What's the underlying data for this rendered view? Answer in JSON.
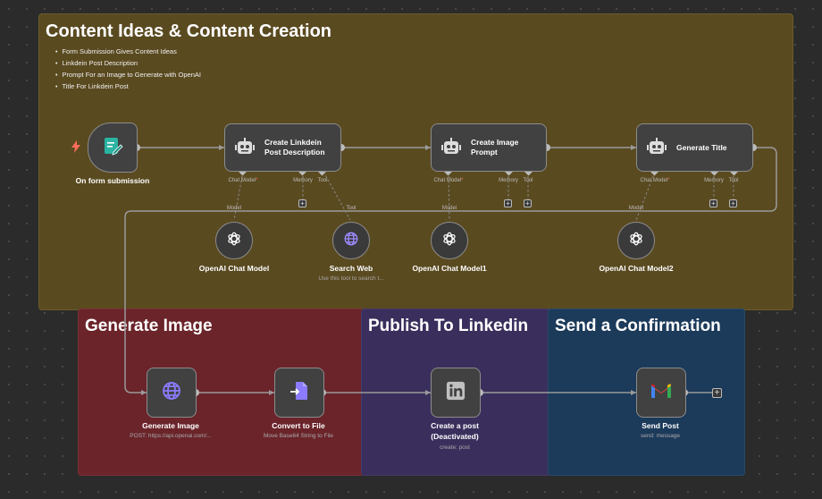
{
  "sticky_main": {
    "title": "Content Ideas & Content Creation",
    "bullets": [
      "Form Submission Gives Content Ideas",
      "Linkdein Post Description",
      "Prompt For an Image to Generate with OpenAI",
      "Title For Linkdein Post"
    ]
  },
  "sticky_image": {
    "title": "Generate Image"
  },
  "sticky_linkedin": {
    "title": "Publish To Linkedin"
  },
  "sticky_send": {
    "title": "Send a Confirmation"
  },
  "nodes": {
    "trigger": {
      "label": "On form submission"
    },
    "agent1": {
      "title": "Create Linkdein Post Description"
    },
    "agent2": {
      "title": "Create Image Prompt"
    },
    "agent3": {
      "title": "Generate Title"
    },
    "model1": {
      "label": "OpenAI Chat Model"
    },
    "search": {
      "label": "Search Web",
      "sub": "Use this tool to search t..."
    },
    "model2": {
      "label": "OpenAI Chat Model1"
    },
    "model3": {
      "label": "OpenAI Chat Model2"
    },
    "genimg": {
      "label": "Generate Image",
      "sub": "POST: https://api.openai.com/..."
    },
    "convert": {
      "label": "Convert to File",
      "sub": "Move Base64 String to File"
    },
    "linkedin": {
      "label_line1": "Create a post",
      "label_line2": "(Deactivated)",
      "sub": "create: post"
    },
    "gmail": {
      "label": "Send Post",
      "sub": "send: message"
    }
  },
  "ports": {
    "chat_model": "Chat Model",
    "memory": "Memory",
    "tool": "Tool",
    "model": "Model",
    "required_mark": "*"
  },
  "colors": {
    "sticky_yellow": "#5a4a20",
    "sticky_red": "#6a242a",
    "sticky_purple": "#3a2f5c",
    "sticky_blue": "#1c3a5a",
    "trigger_icon": "#ff6d5a",
    "linkedin_icon": "#c0c0c0",
    "openai_icon": "#ffffff",
    "http_icon": "#8b7bff"
  }
}
